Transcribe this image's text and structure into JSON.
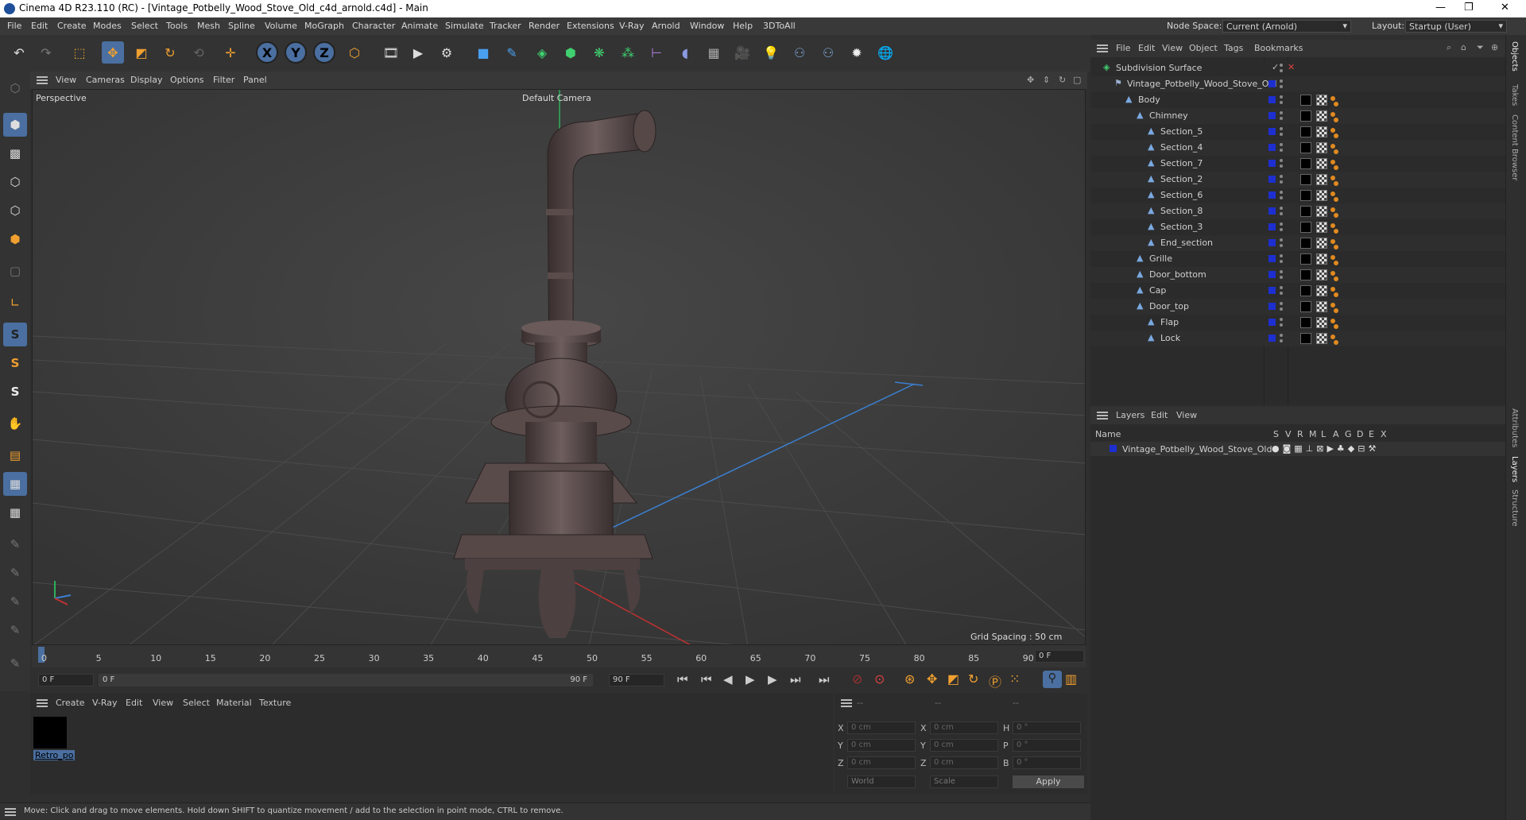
{
  "window": {
    "title": "Cinema 4D R23.110 (RC) - [Vintage_Potbelly_Wood_Stove_Old_c4d_arnold.c4d] - Main",
    "minimize": "—",
    "maximize": "❐",
    "close": "✕"
  },
  "menu": {
    "items": [
      "File",
      "Edit",
      "Create",
      "Modes",
      "Select",
      "Tools",
      "Mesh",
      "Spline",
      "Volume",
      "MoGraph",
      "Character",
      "Animate",
      "Simulate",
      "Tracker",
      "Render",
      "Extensions",
      "V-Ray",
      "Arnold",
      "Window",
      "Help",
      "3DToAll"
    ],
    "node_space_label": "Node Space:",
    "node_space_value": "Current (Arnold)",
    "layout_label": "Layout:",
    "layout_value": "Startup (User)"
  },
  "viewport": {
    "menu": [
      "View",
      "Cameras",
      "Display",
      "Options",
      "Filter",
      "Panel"
    ],
    "name": "Perspective",
    "camera": "Default Camera",
    "grid_spacing": "Grid Spacing : 50 cm"
  },
  "timeline": {
    "ticks": [
      "0",
      "5",
      "10",
      "15",
      "20",
      "25",
      "30",
      "35",
      "40",
      "45",
      "50",
      "55",
      "60",
      "65",
      "70",
      "75",
      "80",
      "85",
      "90"
    ],
    "current_frame": "0 F"
  },
  "transport": {
    "start": "0 F",
    "range_start": "0 F",
    "range_end": "90 F",
    "end": "90 F"
  },
  "material": {
    "menu": [
      "Create",
      "V-Ray",
      "Edit",
      "View",
      "Select",
      "Material",
      "Texture"
    ],
    "swatch_label": "Retro_po"
  },
  "coords": {
    "headers": [
      "--",
      "--",
      "--"
    ],
    "x": "0 cm",
    "y": "0 cm",
    "z": "0 cm",
    "sx": "0 cm",
    "sy": "0 cm",
    "sz": "0 cm",
    "h": "0 °",
    "p": "0 °",
    "b": "0 °",
    "world": "World",
    "scale": "Scale",
    "apply": "Apply",
    "labels": {
      "x": "X",
      "y": "Y",
      "z": "Z",
      "h": "H",
      "p": "P",
      "b": "B"
    }
  },
  "status": "Move: Click and drag to move elements. Hold down SHIFT to quantize movement / add to the selection in point mode, CTRL to remove.",
  "objects": {
    "menu": [
      "File",
      "Edit",
      "View",
      "Object",
      "Tags",
      "Bookmarks"
    ],
    "items": [
      {
        "name": "Subdivision Surface",
        "depth": 0
      },
      {
        "name": "Vintage_Potbelly_Wood_Stove_Old",
        "depth": 1
      },
      {
        "name": "Body",
        "depth": 2
      },
      {
        "name": "Chimney",
        "depth": 3
      },
      {
        "name": "Section_5",
        "depth": 4
      },
      {
        "name": "Section_4",
        "depth": 4
      },
      {
        "name": "Section_7",
        "depth": 4
      },
      {
        "name": "Section_2",
        "depth": 4
      },
      {
        "name": "Section_6",
        "depth": 4
      },
      {
        "name": "Section_8",
        "depth": 4
      },
      {
        "name": "Section_3",
        "depth": 4
      },
      {
        "name": "End_section",
        "depth": 4
      },
      {
        "name": "Grille",
        "depth": 3
      },
      {
        "name": "Door_bottom",
        "depth": 3
      },
      {
        "name": "Cap",
        "depth": 3
      },
      {
        "name": "Door_top",
        "depth": 3
      },
      {
        "name": "Flap",
        "depth": 4
      },
      {
        "name": "Lock",
        "depth": 4
      }
    ]
  },
  "layers": {
    "menu": [
      "Layers",
      "Edit",
      "View"
    ],
    "name_header": "Name",
    "flags": [
      "S",
      "V",
      "R",
      "M",
      "L",
      "A",
      "G",
      "D",
      "E",
      "X"
    ],
    "row": "Vintage_Potbelly_Wood_Stove_Old"
  },
  "sidetabs": [
    "Objects",
    "Takes",
    "Content Browser",
    "Attributes",
    "Layers",
    "Structure"
  ],
  "colors": {
    "layer_color": "#1d2fd0",
    "accent": "#4a7fc0"
  }
}
